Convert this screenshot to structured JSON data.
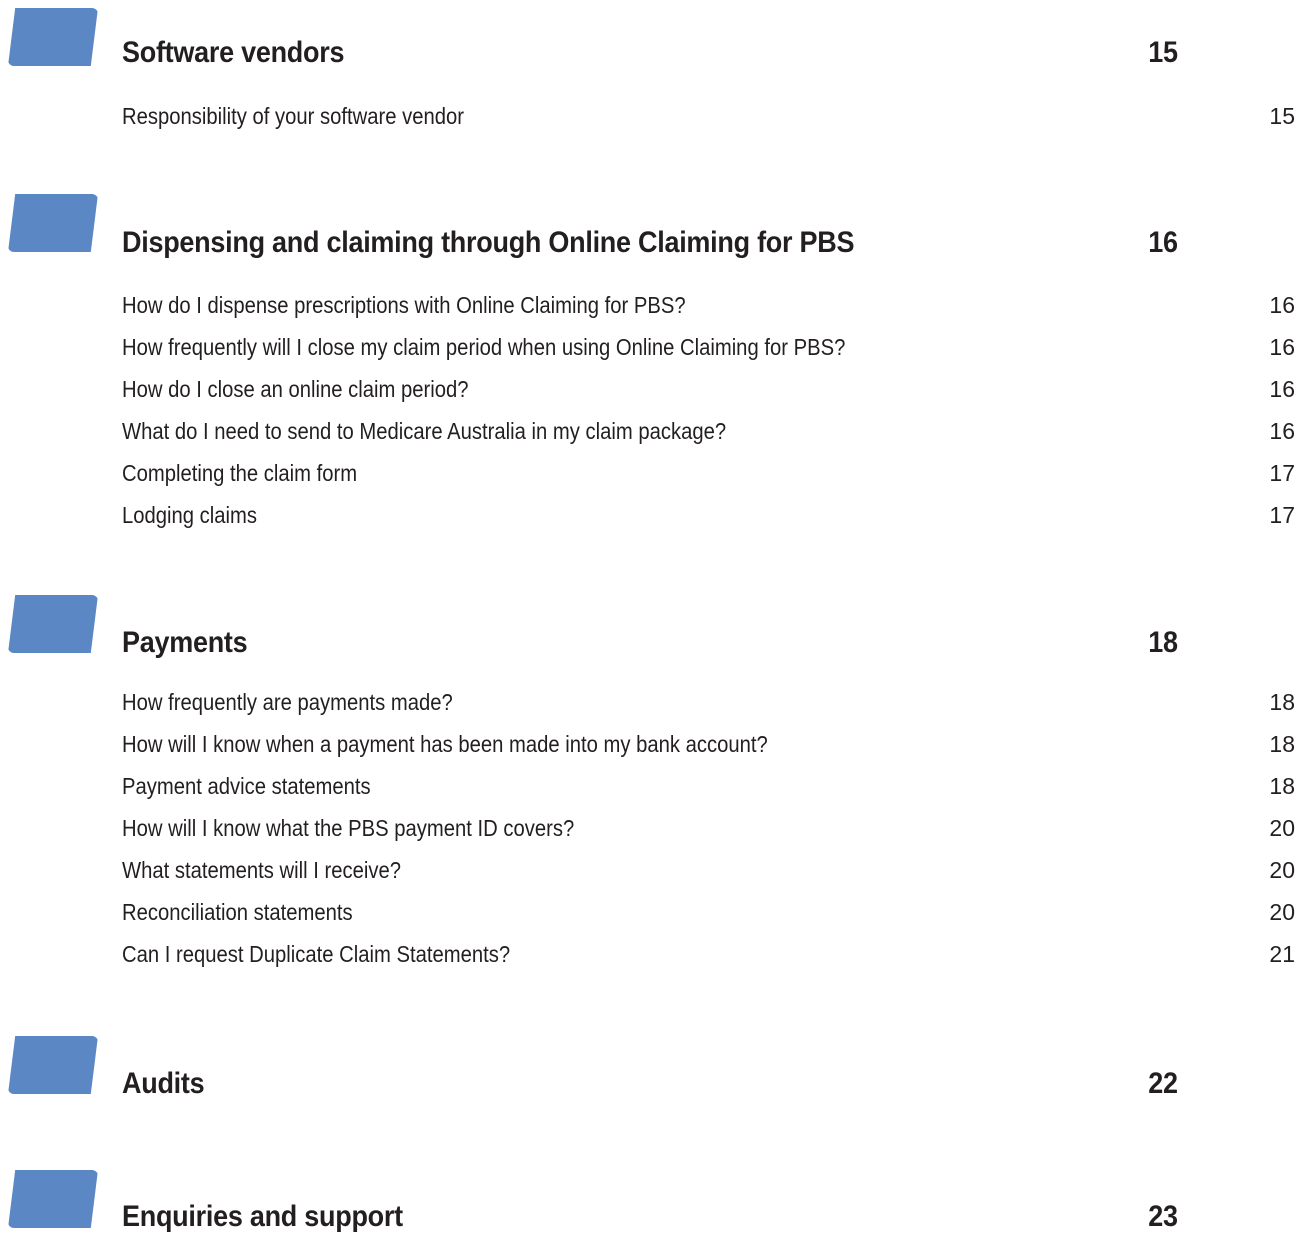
{
  "sections": [
    {
      "title": "Software vendors",
      "page": "15",
      "entries": [
        {
          "title": "Responsibility of your software vendor",
          "page": "15"
        }
      ]
    },
    {
      "title": "Dispensing and claiming through Online Claiming for PBS",
      "page": "16",
      "entries": [
        {
          "title": "How do I dispense prescriptions with Online Claiming for PBS?",
          "page": "16"
        },
        {
          "title": "How frequently will I close my claim period when using Online Claiming for PBS?",
          "page": "16"
        },
        {
          "title": "How do I close an online claim period?",
          "page": "16"
        },
        {
          "title": "What do I need to send to Medicare Australia in my claim package?",
          "page": "16"
        },
        {
          "title": "Completing the claim form",
          "page": "17"
        },
        {
          "title": "Lodging claims",
          "page": "17"
        }
      ]
    },
    {
      "title": "Payments",
      "page": "18",
      "entries": [
        {
          "title": "How frequently are payments made?",
          "page": "18"
        },
        {
          "title": "How will I know when a payment has been made into my bank account?",
          "page": "18"
        },
        {
          "title": "Payment advice statements",
          "page": "18"
        },
        {
          "title": "How will I know what the PBS payment ID covers?",
          "page": "20"
        },
        {
          "title": "What statements will I receive?",
          "page": "20"
        },
        {
          "title": "Reconciliation statements",
          "page": "20"
        },
        {
          "title": "Can I request Duplicate Claim Statements?",
          "page": "21"
        }
      ]
    },
    {
      "title": "Audits",
      "page": "22",
      "entries": []
    },
    {
      "title": "Enquiries and support",
      "page": "23",
      "entries": []
    }
  ],
  "colors": {
    "marker": "#5b87c5",
    "text": "#231f20"
  }
}
